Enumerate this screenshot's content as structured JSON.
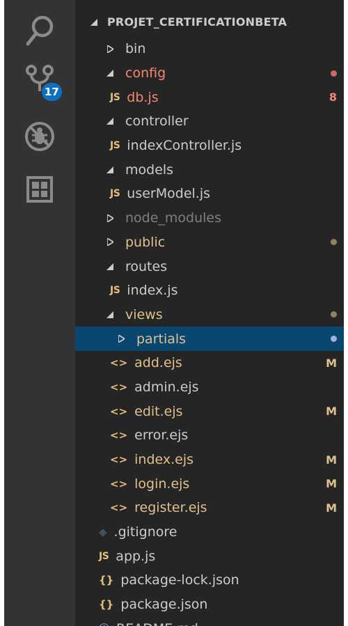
{
  "activity_bar": {
    "items": [
      {
        "name": "search",
        "icon": "search-icon"
      },
      {
        "name": "source-control",
        "icon": "source-control-icon",
        "badge": "17"
      },
      {
        "name": "debug",
        "icon": "debug-icon"
      },
      {
        "name": "extensions",
        "icon": "extensions-icon"
      }
    ]
  },
  "explorer": {
    "title": "PROJET_CERTIFICATIONBETA",
    "colors": {
      "error": "#f48771",
      "modified": "#e2c08d",
      "dim": "#7f7f7f",
      "selected": "#094771",
      "js": "#e5c07b"
    },
    "rows": [
      {
        "label": "bin",
        "type": "folder",
        "expanded": false
      },
      {
        "label": "config",
        "type": "folder",
        "expanded": true,
        "state": "error",
        "dot": "#c76a66"
      },
      {
        "label": "db.js",
        "type": "js",
        "state": "error",
        "badge": "8"
      },
      {
        "label": "controller",
        "type": "folder",
        "expanded": true
      },
      {
        "label": "indexController.js",
        "type": "js"
      },
      {
        "label": "models",
        "type": "folder",
        "expanded": true
      },
      {
        "label": "userModel.js",
        "type": "js"
      },
      {
        "label": "node_modules",
        "type": "folder",
        "expanded": false,
        "state": "dim"
      },
      {
        "label": "public",
        "type": "folder",
        "expanded": false,
        "state": "modified",
        "dot": "#8f8163"
      },
      {
        "label": "routes",
        "type": "folder",
        "expanded": true
      },
      {
        "label": "index.js",
        "type": "js"
      },
      {
        "label": "views",
        "type": "folder",
        "expanded": true,
        "state": "modified",
        "dot": "#8f8163"
      },
      {
        "label": "partials",
        "type": "folder",
        "expanded": false,
        "state": "modified",
        "selected": true,
        "dot": "#9cb4d0"
      },
      {
        "label": "add.ejs",
        "type": "ejs",
        "state": "modified",
        "badge": "M"
      },
      {
        "label": "admin.ejs",
        "type": "ejs"
      },
      {
        "label": "edit.ejs",
        "type": "ejs",
        "state": "modified",
        "badge": "M"
      },
      {
        "label": "error.ejs",
        "type": "ejs"
      },
      {
        "label": "index.ejs",
        "type": "ejs",
        "state": "modified",
        "badge": "M"
      },
      {
        "label": "login.ejs",
        "type": "ejs",
        "state": "modified",
        "badge": "M"
      },
      {
        "label": "register.ejs",
        "type": "ejs",
        "state": "modified",
        "badge": "M"
      },
      {
        "label": ".gitignore",
        "type": "git"
      },
      {
        "label": "app.js",
        "type": "js"
      },
      {
        "label": "package-lock.json",
        "type": "json"
      },
      {
        "label": "package.json",
        "type": "json"
      },
      {
        "label": "README.md",
        "type": "info"
      }
    ],
    "icon_glyphs": {
      "js": "JS",
      "ejs": "<>",
      "json": "{}",
      "git": "◆",
      "info": "ⓘ"
    }
  }
}
